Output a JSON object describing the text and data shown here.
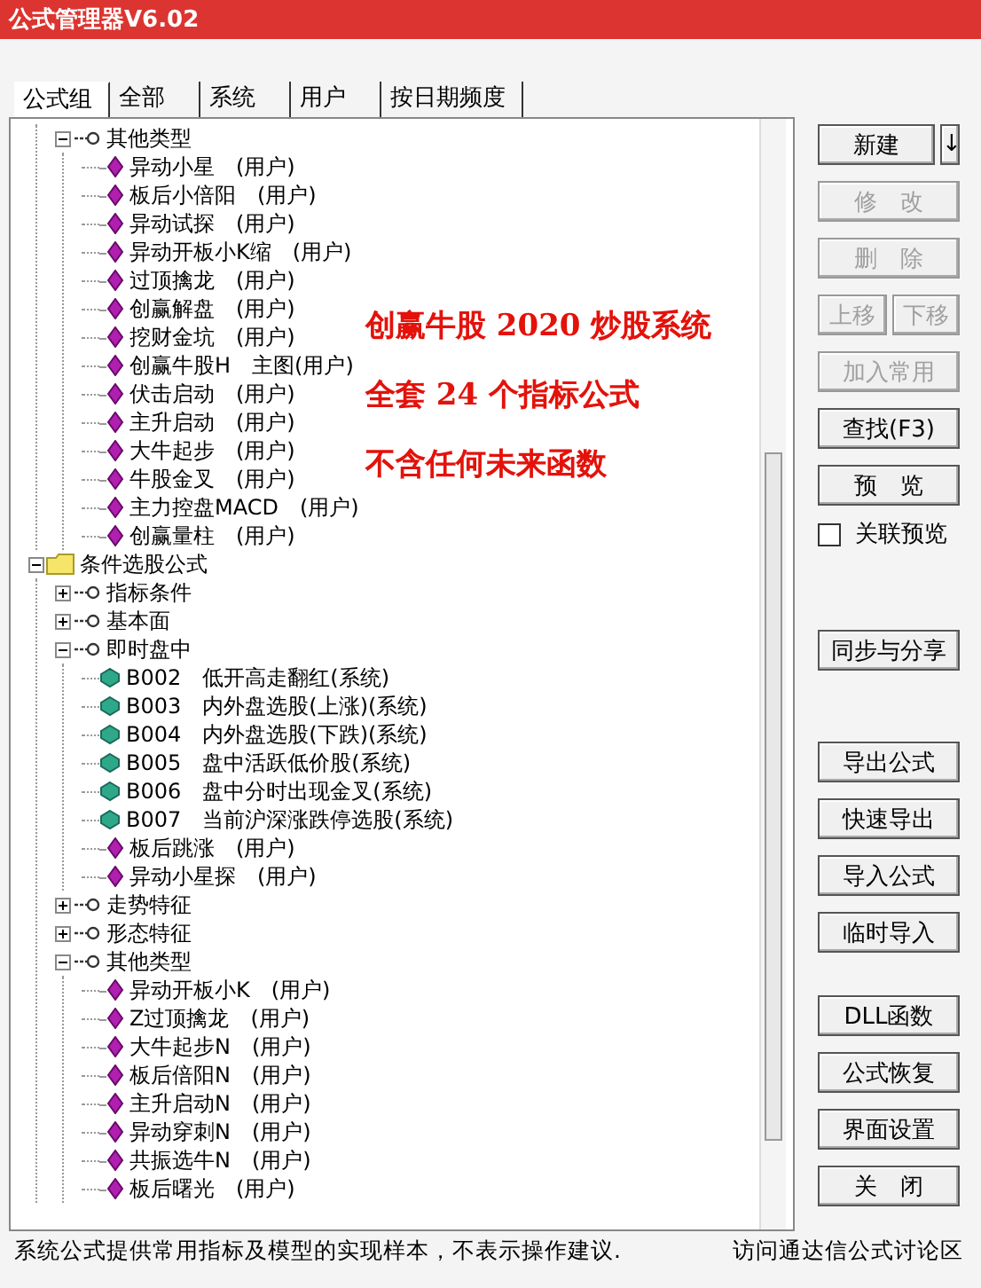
{
  "window": {
    "title": "公式管理器V6.02"
  },
  "tabs": [
    {
      "label": "公式组",
      "selected": true
    },
    {
      "label": "全部",
      "selected": false
    },
    {
      "label": "系统",
      "selected": false
    },
    {
      "label": "用户",
      "selected": false
    },
    {
      "label": "按日期频度",
      "selected": false
    }
  ],
  "tree": {
    "continued": [
      {
        "kind": "group",
        "label": "其他类型",
        "expanded": true,
        "children": [
          {
            "kind": "user",
            "label": "异动小星　(用户)"
          },
          {
            "kind": "user",
            "label": "板后小倍阳　(用户)"
          },
          {
            "kind": "user",
            "label": "异动试探　(用户)"
          },
          {
            "kind": "user",
            "label": "异动开板小K缩　(用户)"
          },
          {
            "kind": "user",
            "label": "过顶擒龙　(用户)"
          },
          {
            "kind": "user",
            "label": "创赢解盘　(用户)"
          },
          {
            "kind": "user",
            "label": "挖财金坑　(用户)"
          },
          {
            "kind": "user",
            "label": "创赢牛股H　主图(用户)"
          },
          {
            "kind": "user",
            "label": "伏击启动　(用户)"
          },
          {
            "kind": "user",
            "label": "主升启动　(用户)"
          },
          {
            "kind": "user",
            "label": "大牛起步　(用户)"
          },
          {
            "kind": "user",
            "label": "牛股金叉　(用户)"
          },
          {
            "kind": "user",
            "label": "主力控盘MACD　(用户)"
          },
          {
            "kind": "user",
            "label": "创赢量柱　(用户)"
          }
        ]
      }
    ],
    "roots": [
      {
        "kind": "folder",
        "label": "条件选股公式",
        "expanded": true,
        "children": [
          {
            "kind": "group",
            "label": "指标条件",
            "expanded": false
          },
          {
            "kind": "group",
            "label": "基本面",
            "expanded": false
          },
          {
            "kind": "group",
            "label": "即时盘中",
            "expanded": true,
            "children": [
              {
                "kind": "system",
                "label": "B002　低开高走翻红(系统)"
              },
              {
                "kind": "system",
                "label": "B003　内外盘选股(上涨)(系统)"
              },
              {
                "kind": "system",
                "label": "B004　内外盘选股(下跌)(系统)"
              },
              {
                "kind": "system",
                "label": "B005　盘中活跃低价股(系统)"
              },
              {
                "kind": "system",
                "label": "B006　盘中分时出现金叉(系统)"
              },
              {
                "kind": "system",
                "label": "B007　当前沪深涨跌停选股(系统)"
              },
              {
                "kind": "user",
                "label": "板后跳涨　(用户)"
              },
              {
                "kind": "user",
                "label": "异动小星探　(用户)"
              }
            ]
          },
          {
            "kind": "group",
            "label": "走势特征",
            "expanded": false
          },
          {
            "kind": "group",
            "label": "形态特征",
            "expanded": false
          },
          {
            "kind": "group",
            "label": "其他类型",
            "expanded": true,
            "children": [
              {
                "kind": "user",
                "label": "异动开板小K　(用户)"
              },
              {
                "kind": "user",
                "label": "Z过顶擒龙　(用户)"
              },
              {
                "kind": "user",
                "label": "大牛起步N　(用户)"
              },
              {
                "kind": "user",
                "label": "板后倍阳N　(用户)"
              },
              {
                "kind": "user",
                "label": "主升启动N　(用户)"
              },
              {
                "kind": "user",
                "label": "异动穿刺N　(用户)"
              },
              {
                "kind": "user",
                "label": "共振选牛N　(用户)"
              },
              {
                "kind": "user",
                "label": "板后曙光　(用户)"
              }
            ]
          }
        ]
      }
    ]
  },
  "overlay": [
    "创赢牛股 2020 炒股系统",
    "全套 24 个指标公式",
    "不含任何未来函数"
  ],
  "button_groups": [
    {
      "items": [
        {
          "kind": "split",
          "label": "新建",
          "arrow": "↓",
          "disabled": false
        },
        {
          "kind": "button",
          "label": "修　改",
          "disabled": true
        },
        {
          "kind": "button",
          "label": "删　除",
          "disabled": true
        },
        {
          "kind": "pair",
          "buttons": [
            {
              "label": "上移",
              "disabled": true
            },
            {
              "label": "下移",
              "disabled": true
            }
          ]
        },
        {
          "kind": "button",
          "label": "加入常用",
          "disabled": true
        },
        {
          "kind": "button",
          "label": "查找(F3)",
          "disabled": false
        },
        {
          "kind": "button",
          "label": "预　览",
          "disabled": false
        },
        {
          "kind": "checkbox",
          "label": "关联预览",
          "checked": false
        }
      ]
    },
    {
      "items": [
        {
          "kind": "button",
          "label": "同步与分享",
          "disabled": false
        }
      ]
    },
    {
      "items": [
        {
          "kind": "button",
          "label": "导出公式",
          "disabled": false
        },
        {
          "kind": "button",
          "label": "快速导出",
          "disabled": false
        },
        {
          "kind": "button",
          "label": "导入公式",
          "disabled": false
        },
        {
          "kind": "button",
          "label": "临时导入",
          "disabled": false
        }
      ]
    },
    {
      "items": [
        {
          "kind": "button",
          "label": "DLL函数",
          "disabled": false
        },
        {
          "kind": "button",
          "label": "公式恢复",
          "disabled": false
        },
        {
          "kind": "button",
          "label": "界面设置",
          "disabled": false
        },
        {
          "kind": "button",
          "label": "关　闭",
          "disabled": false
        }
      ]
    }
  ],
  "status_bar": {
    "text": "系统公式提供常用指标及模型的实现样本，不表示操作建议.",
    "link": "访问通达信公式讨论区"
  }
}
